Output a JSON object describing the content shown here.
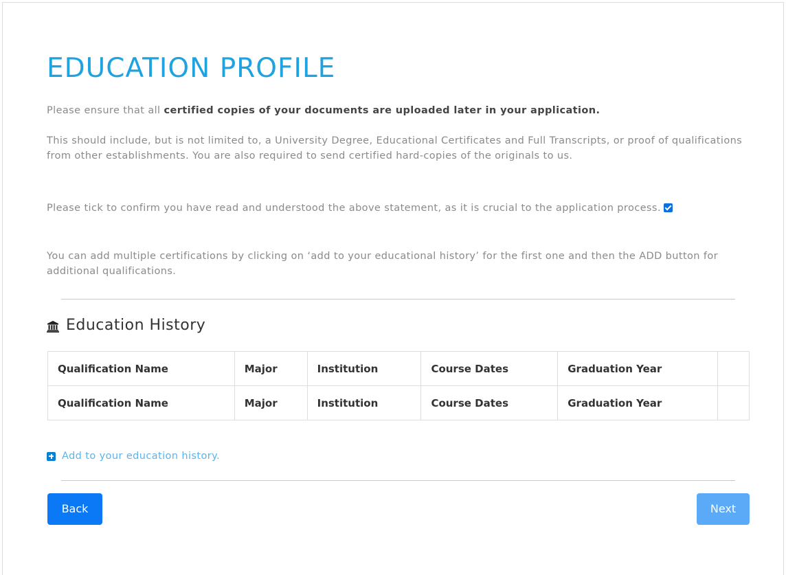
{
  "page": {
    "title": "EDUCATION PROFILE"
  },
  "intro": {
    "line1_prefix": "Please ensure that all ",
    "line1_bold": "certified copies of your documents are uploaded later in your application.",
    "para2": "This should include, but is not limited to, a University Degree, Educational Certificates and Full Transcripts, or proof of qualifications from other establishments. You are also required to send certified hard-copies of the originals to us.",
    "para3": "Please tick to confirm you have read and understood the above statement, as it is crucial to the application process.",
    "confirm_checked": true,
    "para4": "You can add multiple certifications by clicking on ‘add to your educational history’ for the first one and then the ADD button for additional qualifications."
  },
  "history": {
    "section_title": "Education History",
    "icon": "bank-icon",
    "columns": [
      "Qualification Name",
      "Major",
      "Institution",
      "Course Dates",
      "Graduation Year",
      ""
    ],
    "rows": [
      [
        "Qualification Name",
        "Major",
        "Institution",
        "Course Dates",
        "Graduation Year",
        ""
      ],
      [
        "Qualification Name",
        "Major",
        "Institution",
        "Course Dates",
        "Graduation Year",
        ""
      ]
    ],
    "add_link": "Add to your education history.",
    "add_icon": "plus-square-icon"
  },
  "nav": {
    "back_label": "Back",
    "next_label": "Next"
  },
  "colors": {
    "title": "#1fa3e0",
    "back_button": "#0b78f5",
    "next_button": "#5aaaf8",
    "link": "#5cb3ea"
  }
}
